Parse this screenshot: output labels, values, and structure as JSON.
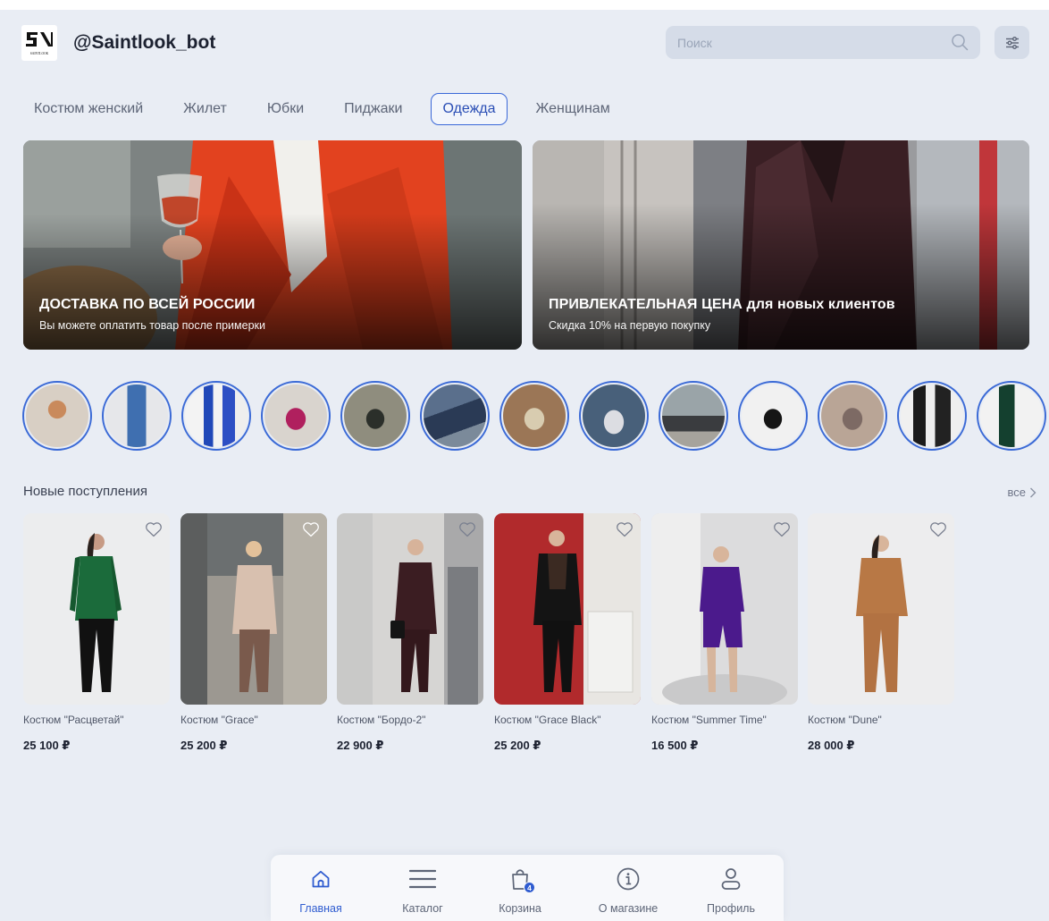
{
  "header": {
    "bot_name": "@Saintlook_bot",
    "logo_text": "SAINTLOOK",
    "search_placeholder": "Поиск"
  },
  "tabs": [
    {
      "label": "Костюм женский",
      "active": false
    },
    {
      "label": "Жилет",
      "active": false
    },
    {
      "label": "Юбки",
      "active": false
    },
    {
      "label": "Пиджаки",
      "active": false
    },
    {
      "label": "Одежда",
      "active": true
    },
    {
      "label": "Женщинам",
      "active": false
    }
  ],
  "banners": [
    {
      "title": "ДОСТАВКА ПО ВСЕЙ РОССИИ",
      "subtitle": "Вы можете оплатить товар после примерки"
    },
    {
      "title": "ПРИВЛЕКАТЕЛЬНАЯ ЦЕНА для новых клиентов",
      "subtitle": "Скидка 10% на первую покупку"
    }
  ],
  "stories_count": 13,
  "new_arrivals": {
    "title": "Новые поступления",
    "see_all": "все",
    "products": [
      {
        "name": "Костюм \"Расцветай\"",
        "price": "25 100 ₽"
      },
      {
        "name": "Костюм \"Grace\"",
        "price": "25 200 ₽"
      },
      {
        "name": "Костюм \"Бордо-2\"",
        "price": "22 900 ₽"
      },
      {
        "name": "Костюм \"Grace Black\"",
        "price": "25 200 ₽"
      },
      {
        "name": "Костюм \"Summer Time\"",
        "price": "16 500 ₽"
      },
      {
        "name": "Костюм \"Dune\"",
        "price": "28 000 ₽"
      }
    ]
  },
  "bottom_nav": {
    "items": [
      {
        "label": "Главная",
        "icon": "home-icon",
        "active": true
      },
      {
        "label": "Каталог",
        "icon": "menu-icon",
        "active": false
      },
      {
        "label": "Корзина",
        "icon": "bag-icon",
        "active": false,
        "badge": "4"
      },
      {
        "label": "О магазине",
        "icon": "info-icon",
        "active": false
      },
      {
        "label": "Профиль",
        "icon": "user-icon",
        "active": false
      }
    ]
  },
  "colors": {
    "accent": "#3a68d8",
    "background": "#e9edf4",
    "search_bg": "#d5dce8"
  }
}
